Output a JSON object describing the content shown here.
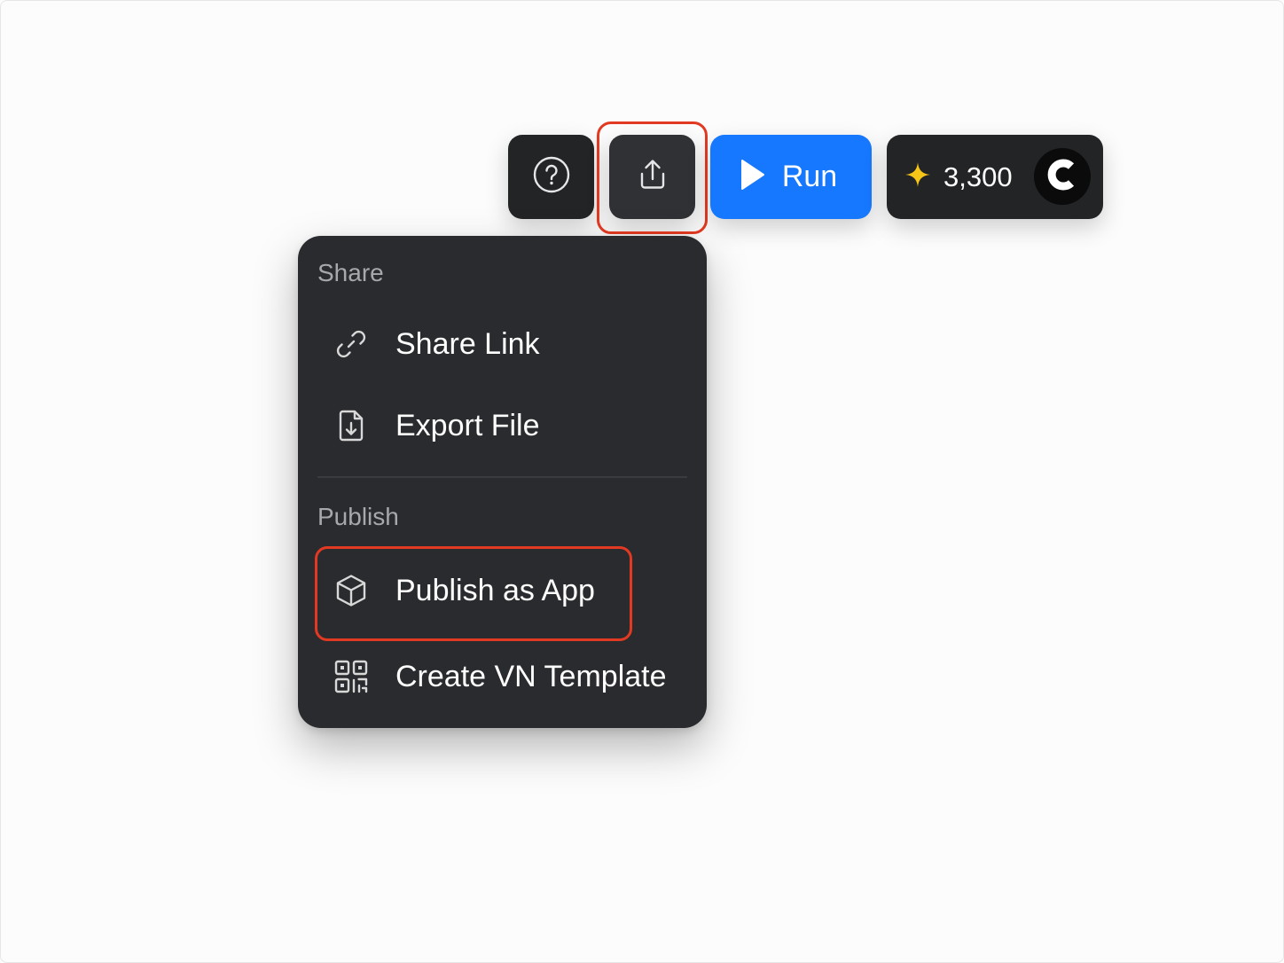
{
  "toolbar": {
    "help_icon": "question-circle-icon",
    "share_icon": "share-upload-icon",
    "run_label": "Run",
    "run_icon": "play-icon",
    "credits": {
      "icon": "sparkle-star-icon",
      "count": "3,300",
      "avatar_icon": "c-logo-icon"
    }
  },
  "menu": {
    "share_section": {
      "title": "Share",
      "items": [
        {
          "label": "Share Link",
          "icon": "link-icon"
        },
        {
          "label": "Export File",
          "icon": "file-download-icon"
        }
      ]
    },
    "publish_section": {
      "title": "Publish",
      "items": [
        {
          "label": "Publish as App",
          "icon": "cube-icon",
          "highlighted": true
        },
        {
          "label": "Create VN Template",
          "icon": "qr-code-icon"
        }
      ]
    }
  },
  "colors": {
    "run_button": "#1677ff",
    "highlight": "#e23a22",
    "menu_bg": "#2a2b2e",
    "sparkle": "#f5c518"
  }
}
